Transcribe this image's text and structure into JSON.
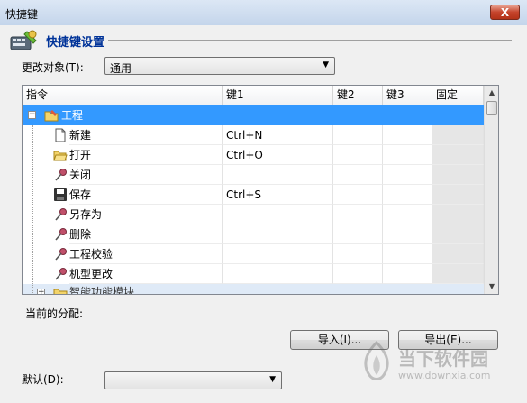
{
  "window": {
    "title": "快捷键",
    "close_glyph": "X"
  },
  "header": {
    "title": "快捷键设置"
  },
  "target": {
    "label": "更改对象(T):",
    "value": "通用"
  },
  "table": {
    "columns": [
      "指令",
      "键1",
      "键2",
      "键3",
      "固定"
    ],
    "group": {
      "expander": "−",
      "label": "工程"
    },
    "rows": [
      {
        "label": "新建",
        "key1": "Ctrl+N",
        "icon": "new-file-icon"
      },
      {
        "label": "打开",
        "key1": "Ctrl+O",
        "icon": "open-folder-icon"
      },
      {
        "label": "关闭",
        "key1": "",
        "icon": "pin-icon"
      },
      {
        "label": "保存",
        "key1": "Ctrl+S",
        "icon": "save-icon"
      },
      {
        "label": "另存为",
        "key1": "",
        "icon": "pin-icon"
      },
      {
        "label": "删除",
        "key1": "",
        "icon": "pin-icon"
      },
      {
        "label": "工程校验",
        "key1": "",
        "icon": "pin-icon"
      },
      {
        "label": "机型更改",
        "key1": "",
        "icon": "pin-icon"
      }
    ],
    "next_group": {
      "expander": "+",
      "label": "智能功能模块"
    }
  },
  "current_assignment_label": "当前的分配:",
  "buttons": {
    "import": "导入(I)...",
    "export": "导出(E)..."
  },
  "default": {
    "label": "默认(D):",
    "value": ""
  },
  "watermark": {
    "brand": "当下软件园",
    "url": "www.downxia.com"
  },
  "colors": {
    "selection": "#3399ff",
    "header_title": "#003399"
  }
}
